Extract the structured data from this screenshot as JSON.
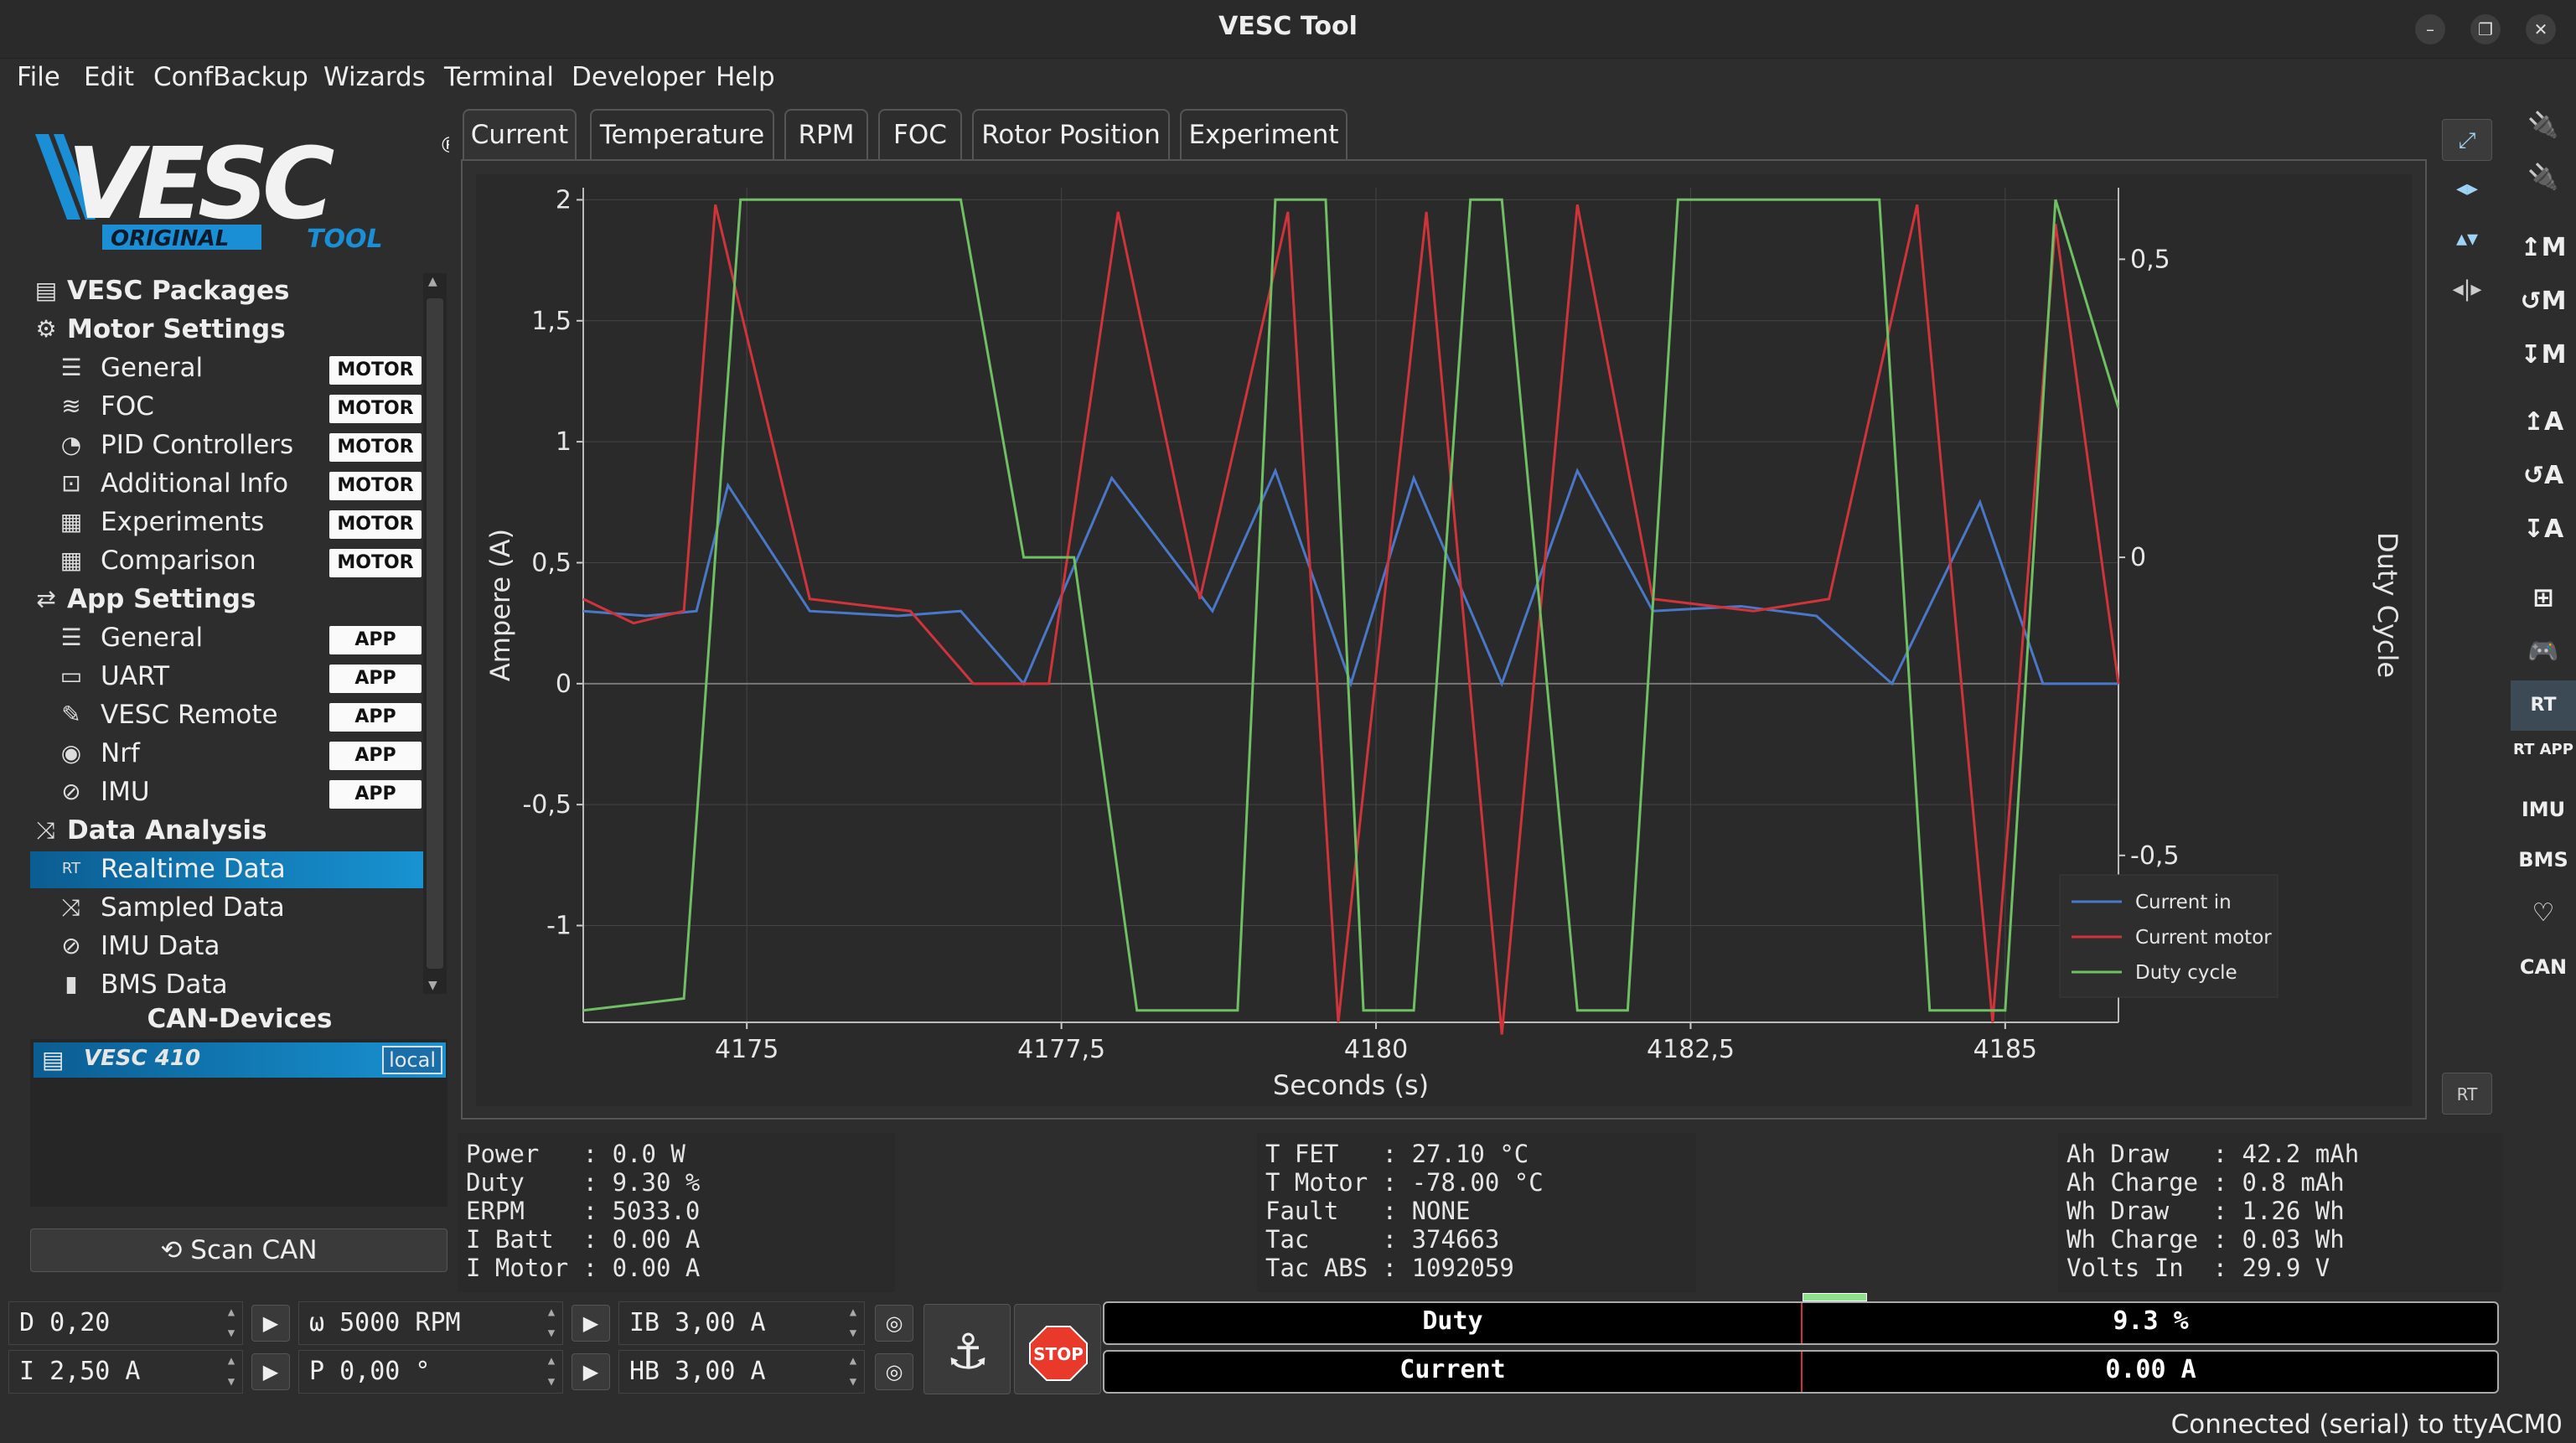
{
  "window": {
    "title": "VESC Tool",
    "buttons": [
      "–",
      "❐",
      "✕"
    ]
  },
  "menu": [
    "File",
    "Edit",
    "ConfBackup",
    "Wizards",
    "Terminal",
    "Developer",
    "Help"
  ],
  "logo": {
    "main": "VESC",
    "sub1": "ORIGINAL",
    "sub2": "TOOL",
    "mark": "®"
  },
  "tree": [
    {
      "label": "VESC Packages",
      "type": "group",
      "icon": "package-icon",
      "glyph": "▤"
    },
    {
      "label": "Motor Settings",
      "type": "group",
      "icon": "motor-icon",
      "glyph": "⚙"
    },
    {
      "label": "General",
      "type": "item",
      "badge": "MOTOR",
      "icon": "sliders-icon",
      "glyph": "☰"
    },
    {
      "label": "FOC",
      "type": "item",
      "badge": "MOTOR",
      "icon": "coil-icon",
      "glyph": "≋"
    },
    {
      "label": "PID Controllers",
      "type": "item",
      "badge": "MOTOR",
      "icon": "gauge-icon",
      "glyph": "◔"
    },
    {
      "label": "Additional Info",
      "type": "item",
      "badge": "MOTOR",
      "icon": "info-icon",
      "glyph": "⊡"
    },
    {
      "label": "Experiments",
      "type": "item",
      "badge": "MOTOR",
      "icon": "calculator-icon",
      "glyph": "▦"
    },
    {
      "label": "Comparison",
      "type": "item",
      "badge": "MOTOR",
      "icon": "calculator-icon",
      "glyph": "▦"
    },
    {
      "label": "App Settings",
      "type": "group",
      "icon": "app-settings-icon",
      "glyph": "⇄"
    },
    {
      "label": "General",
      "type": "item",
      "badge": "APP",
      "icon": "sliders-icon",
      "glyph": "☰"
    },
    {
      "label": "UART",
      "type": "item",
      "badge": "APP",
      "icon": "uart-icon",
      "glyph": "▭"
    },
    {
      "label": "VESC Remote",
      "type": "item",
      "badge": "APP",
      "icon": "remote-icon",
      "glyph": "✎"
    },
    {
      "label": "Nrf",
      "type": "item",
      "badge": "APP",
      "icon": "wireless-icon",
      "glyph": "◉"
    },
    {
      "label": "IMU",
      "type": "item",
      "badge": "APP",
      "icon": "imu-icon",
      "glyph": "⊘"
    },
    {
      "label": "Data Analysis",
      "type": "group",
      "icon": "analysis-icon",
      "glyph": "⤨"
    },
    {
      "label": "Realtime Data",
      "type": "item",
      "selected": true,
      "icon": "realtime-icon",
      "glyph": "RT"
    },
    {
      "label": "Sampled Data",
      "type": "item",
      "icon": "sampled-icon",
      "glyph": "⤨"
    },
    {
      "label": "IMU Data",
      "type": "item",
      "icon": "imu-icon",
      "glyph": "⊘"
    },
    {
      "label": "BMS Data",
      "type": "item",
      "icon": "battery-icon",
      "glyph": "▮"
    }
  ],
  "can": {
    "title": "CAN-Devices",
    "device": "410",
    "device_logo": "VESC",
    "local": "local",
    "scan": "Scan CAN"
  },
  "tabs": [
    "Current",
    "Temperature",
    "RPM",
    "FOC",
    "Rotor Position",
    "Experiment"
  ],
  "chart_data": {
    "type": "line",
    "xlabel": "Seconds (s)",
    "ylabel": "Ampere (A)",
    "y2label": "Duty Cycle",
    "xlim": [
      4173.7,
      4185.9
    ],
    "ylim": [
      -1.4,
      2.05
    ],
    "y2lim": [
      -0.78,
      0.62
    ],
    "xticks": [
      4175,
      4177.5,
      4180,
      4182.5,
      4185
    ],
    "xtick_labels": [
      "4175",
      "4177,5",
      "4180",
      "4182,5",
      "4185"
    ],
    "yticks": [
      -1,
      -0.5,
      0,
      0.5,
      1,
      1.5,
      2
    ],
    "ytick_labels": [
      "-1",
      "-0,5",
      "0",
      "0,5",
      "1",
      "1,5",
      "2"
    ],
    "y2ticks": [
      -0.5,
      0,
      0.5
    ],
    "y2tick_labels": [
      "-0,5",
      "0",
      "0,5"
    ],
    "grid": true,
    "legend_position": "bottom-right",
    "series": [
      {
        "name": "Current in",
        "color": "#4a78c8",
        "x": [
          4173.7,
          4174.2,
          4174.6,
          4174.85,
          4175.5,
          4176.2,
          4176.7,
          4177.2,
          4177.9,
          4178.7,
          4179.2,
          4179.8,
          4180.3,
          4181.0,
          4181.6,
          4182.2,
          4182.9,
          4183.5,
          4184.1,
          4184.8,
          4185.3,
          4185.9
        ],
        "y": [
          0.3,
          0.28,
          0.3,
          0.82,
          0.3,
          0.28,
          0.3,
          0.0,
          0.85,
          0.3,
          0.88,
          0.0,
          0.85,
          0.0,
          0.88,
          0.3,
          0.32,
          0.28,
          0.0,
          0.75,
          0.0,
          0.0
        ]
      },
      {
        "name": "Current motor",
        "color": "#d0343a",
        "x": [
          4173.7,
          4174.1,
          4174.5,
          4174.75,
          4175.5,
          4176.3,
          4176.8,
          4177.4,
          4177.95,
          4178.6,
          4179.3,
          4179.7,
          4180.4,
          4181.0,
          4181.6,
          4182.2,
          4183.0,
          4183.6,
          4184.3,
          4184.9,
          4185.4,
          4185.9
        ],
        "y": [
          0.35,
          0.25,
          0.3,
          1.98,
          0.35,
          0.3,
          0.0,
          0.0,
          1.95,
          0.35,
          1.95,
          -1.4,
          1.95,
          -1.45,
          1.98,
          0.35,
          0.3,
          0.35,
          1.98,
          -1.4,
          1.9,
          0.0
        ]
      },
      {
        "name": "Duty cycle",
        "color": "#6fbf63",
        "x": [
          4173.7,
          4174.5,
          4174.95,
          4176.7,
          4177.2,
          4177.6,
          4178.1,
          4178.9,
          4179.2,
          4179.6,
          4179.9,
          4180.3,
          4180.75,
          4181.0,
          4181.6,
          4182.0,
          4182.4,
          4184.0,
          4184.4,
          4185.0,
          4185.4,
          4185.9
        ],
        "y": [
          -0.76,
          -0.74,
          0.6,
          0.6,
          0.0,
          0.0,
          -0.76,
          -0.76,
          0.6,
          0.6,
          -0.76,
          -0.76,
          0.6,
          0.6,
          -0.76,
          -0.76,
          0.6,
          0.6,
          -0.76,
          -0.76,
          0.6,
          0.25
        ]
      }
    ]
  },
  "panels": {
    "left": "Power   : 0.0 W\nDuty    : 9.30 %\nERPM    : 5033.0\nI Batt  : 0.00 A\nI Motor : 0.00 A",
    "mid": "T FET   : 27.10 °C\nT Motor : -78.00 °C\nFault   : NONE\nTac     : 374663\nTac ABS : 1092059",
    "right": "Ah Draw   : 42.2 mAh\nAh Charge : 0.8 mAh\nWh Draw   : 1.26 Wh\nWh Charge : 0.03 Wh\nVolts In  : 29.9 V"
  },
  "controls": {
    "duty": "D 0,20",
    "rpm": "ω 5000 RPM",
    "ib": "IB 3,00 A",
    "current": "I 2,50 A",
    "pos": "P 0,00 °",
    "hb": "HB 3,00 A",
    "stop": "STOP"
  },
  "bars": {
    "duty_label": "Duty",
    "duty_value": "9.3 %",
    "duty_level": 0.093,
    "current_label": "Current",
    "current_value": "0.00 A"
  },
  "right_tools": [
    "RT",
    "RT APP",
    "IMU",
    "BMS",
    "CAN"
  ],
  "status": "Connected (serial) to ttyACM0"
}
